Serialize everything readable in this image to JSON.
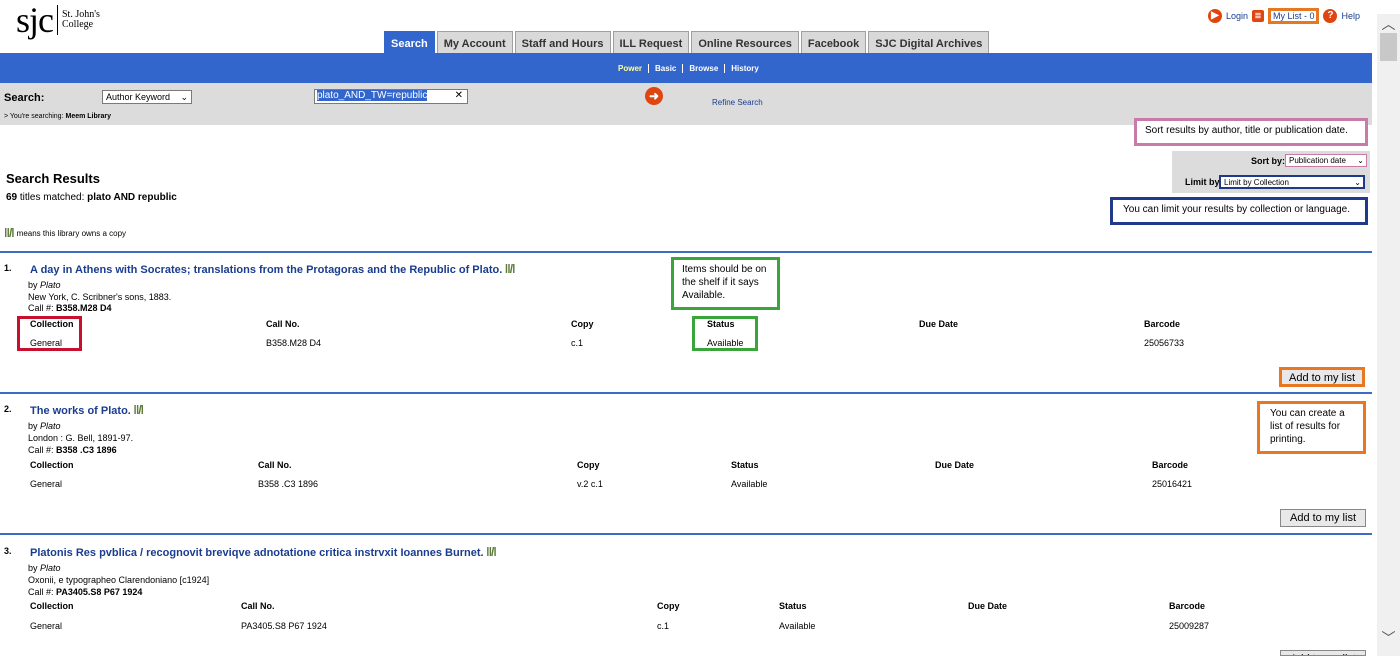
{
  "logo": {
    "abbr": "sjc",
    "line1": "St. John's",
    "line2": "College"
  },
  "toplinks": {
    "login": "Login",
    "mylist": "My List - 0",
    "help": "Help"
  },
  "tabs": [
    "Search",
    "My Account",
    "Staff and Hours",
    "ILL Request",
    "Online Resources",
    "Facebook",
    "SJC Digital Archives"
  ],
  "subnav": [
    "Power",
    "Basic",
    "Browse",
    "History"
  ],
  "search": {
    "label": "Search:",
    "type_value": "Author Keyword",
    "query": "plato_AND_TW=republic",
    "refine": "Refine Search",
    "searching_prefix": "> You're searching:",
    "library": "Meem Library"
  },
  "sort": {
    "label": "Sort by:",
    "value": "Publication date",
    "limit_label": "Limit by",
    "limit_value": "Limit by Collection"
  },
  "callouts": {
    "sort": "Sort results by author, title or publication date.",
    "limit": "You can limit your results by collection or language.",
    "shelf": "Items should be on the shelf if it says Available.",
    "mylist": "You can create a list of results for printing."
  },
  "results_header": {
    "title": "Search Results",
    "count": "69",
    "matched_text": "titles matched:",
    "query": "plato  AND republic",
    "owns": "means this library owns a copy"
  },
  "columns": [
    "Collection",
    "Call No.",
    "Copy",
    "Status",
    "Due Date",
    "Barcode"
  ],
  "add_label": "Add to my list",
  "results": [
    {
      "num": "1.",
      "title": "A day in Athens with Socrates; translations from the Protagoras and the Republic of Plato.",
      "by": "by",
      "author": "Plato",
      "pub": "New York, C. Scribner's sons, 1883.",
      "call_label": "Call #:",
      "call": "B358.M28 D4",
      "row": [
        "General",
        "B358.M28 D4",
        "c.1",
        "Available",
        "",
        "25056733"
      ]
    },
    {
      "num": "2.",
      "title": "The works of Plato.",
      "by": "by",
      "author": "Plato",
      "pub": "London : G. Bell, 1891-97.",
      "call_label": "Call #:",
      "call": "B358 .C3 1896",
      "row": [
        "General",
        "B358 .C3 1896",
        "v.2 c.1",
        "Available",
        "",
        "25016421"
      ]
    },
    {
      "num": "3.",
      "title": "Platonis Res pvblica / recognovit breviqve adnotatione critica instrvxit Ioannes Burnet.",
      "by": "by",
      "author": "Plato",
      "pub": "Oxonii, e typographeo Clarendoniano [c1924]",
      "call_label": "Call #:",
      "call": "PA3405.S8 P67 1924",
      "row": [
        "General",
        "PA3405.S8 P67 1924",
        "c.1",
        "Available",
        "",
        "25009287"
      ]
    }
  ],
  "colors": {
    "tabbar": "#3366cc",
    "callout_pink": "#c87aa8",
    "callout_navy": "#1f3a8a",
    "callout_green": "#3aa53a",
    "callout_orange": "#e87722",
    "callout_red": "#c8102e"
  }
}
